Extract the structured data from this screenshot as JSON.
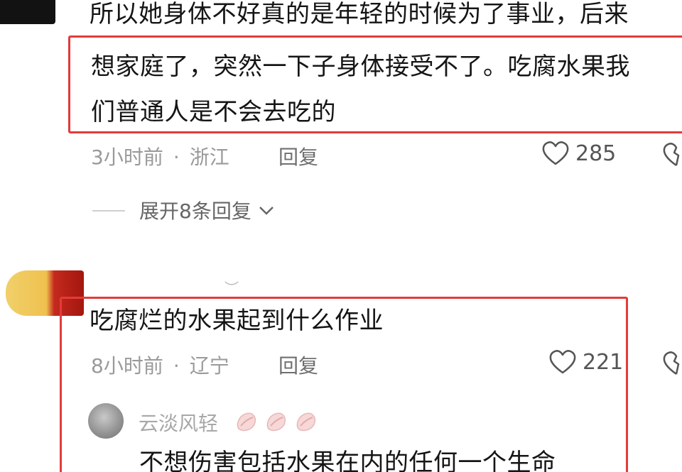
{
  "comment1": {
    "line1": "所以她身体不好真的是年轻的时候为了事业，后来",
    "line2": "想家庭了，突然一下子身体接受不了。吃腐水果我",
    "line3": "们普通人是不会去吃的",
    "time": "3小时前",
    "location": "浙江",
    "reply_label": "回复",
    "likes": "285"
  },
  "expand_replies": "展开8条回复",
  "comment2": {
    "text": "吃腐烂的水果起到什么作业",
    "time": "8小时前",
    "location": "辽宁",
    "reply_label": "回复",
    "likes": "221"
  },
  "subreply": {
    "username": "云淡风轻",
    "text": "不想伤害包括水果在内的任何一个生命"
  },
  "separator": "·",
  "colors": {
    "highlight_box": "#e23b3b",
    "text": "#151515",
    "meta": "#9a9a9a"
  },
  "icons": [
    "heart-outline-icon",
    "broken-heart-icon",
    "chevron-down-icon",
    "lips-emoji-icon"
  ]
}
